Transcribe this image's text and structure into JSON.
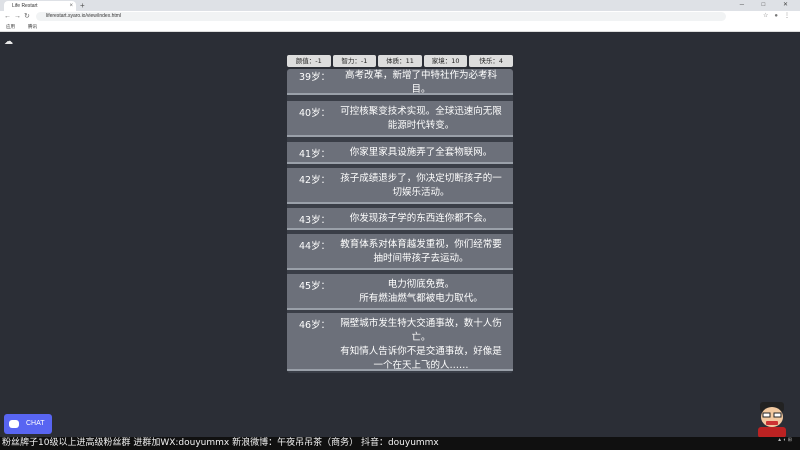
{
  "browser": {
    "tab_title": "Life Restart",
    "url": "liferestart.syaro.io/view/index.html",
    "bookmarks": [
      "应用",
      "腾讯"
    ],
    "new_tab": "+",
    "tab_close": "×"
  },
  "stats": [
    {
      "label": "颜值",
      "value": "-1"
    },
    {
      "label": "智力",
      "value": "-1"
    },
    {
      "label": "体质",
      "value": "11"
    },
    {
      "label": "家境",
      "value": "10"
    },
    {
      "label": "快乐",
      "value": "4"
    }
  ],
  "events": [
    {
      "age": "39岁：",
      "lines": [
        "高考改革，新增了中特社作为必考科目。"
      ]
    },
    {
      "age": "40岁：",
      "lines": [
        "可控核聚变技术实现。全球迅速向无限能源时代转变。"
      ]
    },
    {
      "age": "41岁：",
      "lines": [
        "你家里家具设施弄了全套物联网。"
      ]
    },
    {
      "age": "42岁：",
      "lines": [
        "孩子成绩退步了，你决定切断孩子的一切娱乐活动。"
      ]
    },
    {
      "age": "43岁：",
      "lines": [
        "你发现孩子学的东西连你都不会。"
      ]
    },
    {
      "age": "44岁：",
      "lines": [
        "教育体系对体育越发重视，你们经常要抽时间带孩子去运动。"
      ]
    },
    {
      "age": "45岁：",
      "lines": [
        "电力彻底免费。",
        "所有燃油燃气都被电力取代。"
      ]
    },
    {
      "age": "46岁：",
      "lines": [
        "隔壁城市发生特大交通事故，数十人伤亡。",
        "有知情人告诉你不是交通事故，好像是一个在天上飞的人……"
      ]
    }
  ],
  "chat": {
    "label": "CHAT"
  },
  "banner": "粉丝牌子10级以上进高级粉丝群 进群加WX:douyummx 新浪微博：午夜吊吊茶（商务）   抖音：douyummx",
  "colors": {
    "page_bg": "#2b2e36",
    "card_bg": "#6c707a",
    "chat_bg": "#5865f2"
  }
}
